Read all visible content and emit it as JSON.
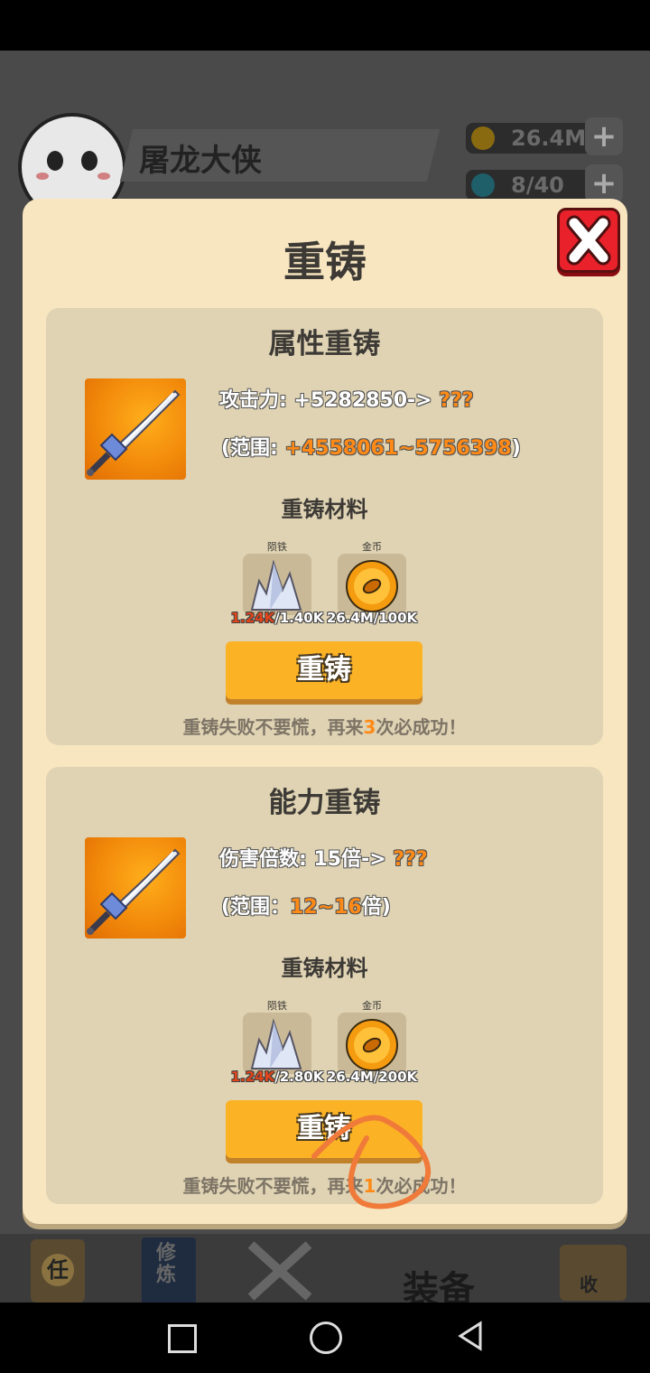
{
  "background": {
    "player_name": "屠龙大侠",
    "gold_amount": "26.4M",
    "energy": "8/40",
    "nav_active_label": "装备",
    "nav_scroll_char": "任",
    "nav_book_text": "修炼",
    "nav_shop_char": "收"
  },
  "modal": {
    "title": "重铸",
    "sections": [
      {
        "title": "属性重铸",
        "stat_label": "攻击力: +5282850-> ",
        "stat_result": "???",
        "range_prefix": "(范围: ",
        "range_value": "+4558061~5756398",
        "range_suffix": ")",
        "materials_title": "重铸材料",
        "materials": [
          {
            "name": "陨铁",
            "have": "1.24K",
            "need": "/1.40K",
            "icon": "crystal-icon"
          },
          {
            "name": "金币",
            "have": "26.4M",
            "need": "/100K",
            "icon": "coin-icon"
          }
        ],
        "button_label": "重铸",
        "hint_prefix": "重铸失败不要慌，再来",
        "hint_count": "3",
        "hint_suffix": "次必成功！"
      },
      {
        "title": "能力重铸",
        "stat_label": "伤害倍数: 15倍-> ",
        "stat_result": "???",
        "range_prefix": "(范围：",
        "range_value": "12~16",
        "range_suffix": "倍)",
        "materials_title": "重铸材料",
        "materials": [
          {
            "name": "陨铁",
            "have": "1.24K",
            "need": "/2.80K",
            "icon": "crystal-icon"
          },
          {
            "name": "金币",
            "have": "26.4M",
            "need": "/200K",
            "icon": "coin-icon"
          }
        ],
        "button_label": "重铸",
        "hint_prefix": "重铸失败不要慌，再来",
        "hint_count": "1",
        "hint_suffix": "次必成功！"
      }
    ]
  },
  "colors": {
    "panel": "#f8e6c0",
    "section": "#dfd3b3",
    "button": "#fbb225",
    "close": "#e8212b",
    "highlight": "#ff8a17"
  }
}
